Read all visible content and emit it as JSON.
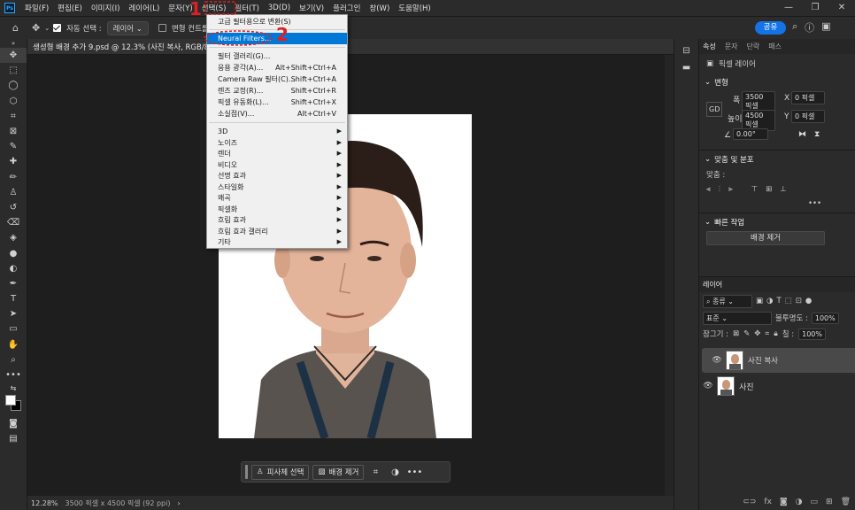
{
  "menubar": {
    "items": [
      "파일(F)",
      "편집(E)",
      "이미지(I)",
      "레이어(L)",
      "문자(Y)",
      "선택(S)",
      "필터(T)",
      "3D(D)",
      "보기(V)",
      "플러그인",
      "창(W)",
      "도움말(H)"
    ]
  },
  "options": {
    "auto_select": "자동 선택 :",
    "layer_select": "레이어",
    "transform": "변형 컨트롤 표시",
    "share": "공유"
  },
  "doc_tab": {
    "title": "생성형 배경 추가 9.psd @ 12.3% (사진 복사, RGB/8) *"
  },
  "status": {
    "zoom": "12.28%",
    "info": "3500 픽셀 x 4500 픽셀 (92 ppi)",
    "arrow": "›"
  },
  "context_bar": {
    "select_subject": "피사체 선택",
    "remove_bg": "배경 제거"
  },
  "filter_menu": {
    "items": [
      {
        "label": "고급 필터용으로 변환(S)",
        "shortcut": ""
      },
      {
        "label": "Neural Filters...",
        "shortcut": ""
      },
      {
        "label": "필터 갤러리(G)...",
        "shortcut": ""
      },
      {
        "label": "응용 광각(A)...",
        "shortcut": "Alt+Shift+Ctrl+A"
      },
      {
        "label": "Camera Raw 필터(C)...",
        "shortcut": "Shift+Ctrl+A"
      },
      {
        "label": "렌즈 교정(R)...",
        "shortcut": "Shift+Ctrl+R"
      },
      {
        "label": "픽셀 유동화(L)...",
        "shortcut": "Shift+Ctrl+X"
      },
      {
        "label": "소실점(V)...",
        "shortcut": "Alt+Ctrl+V"
      },
      {
        "label": "3D",
        "shortcut": ""
      },
      {
        "label": "노이즈",
        "shortcut": ""
      },
      {
        "label": "렌더",
        "shortcut": ""
      },
      {
        "label": "비디오",
        "shortcut": ""
      },
      {
        "label": "선명 효과",
        "shortcut": ""
      },
      {
        "label": "스타일화",
        "shortcut": ""
      },
      {
        "label": "왜곡",
        "shortcut": ""
      },
      {
        "label": "픽셀화",
        "shortcut": ""
      },
      {
        "label": "흐림 효과",
        "shortcut": ""
      },
      {
        "label": "흐림 효과 갤러리",
        "shortcut": ""
      },
      {
        "label": "기타",
        "shortcut": ""
      }
    ]
  },
  "annotations": {
    "step1": "1",
    "step2": "2"
  },
  "props": {
    "tabs": [
      "속성",
      "문자",
      "단락",
      "패스"
    ],
    "pixel_layer": "픽셀 레이어",
    "transform_hdr": "변형",
    "w_label": "폭",
    "w_val": "3500 픽셀",
    "x_label": "X",
    "x_val": "0 픽셀",
    "h_label": "높이",
    "h_val": "4500 픽셀",
    "y_label": "Y",
    "y_val": "0 픽셀",
    "link_label": "GD",
    "angle": "0.00°",
    "align_hdr": "맞춤 및 분포",
    "align_label": "맞춤 :",
    "quick_hdr": "빠른 작업",
    "remove_bg": "배경 제거"
  },
  "layers": {
    "tab": "레이어",
    "kind": "종류",
    "blend": "표준",
    "opacity_label": "불투명도 :",
    "opacity": "100%",
    "lock_label": "잠그기 :",
    "fill_label": "칠 :",
    "fill": "100%",
    "items": [
      {
        "name": "사진 복사"
      },
      {
        "name": "사진"
      }
    ]
  }
}
